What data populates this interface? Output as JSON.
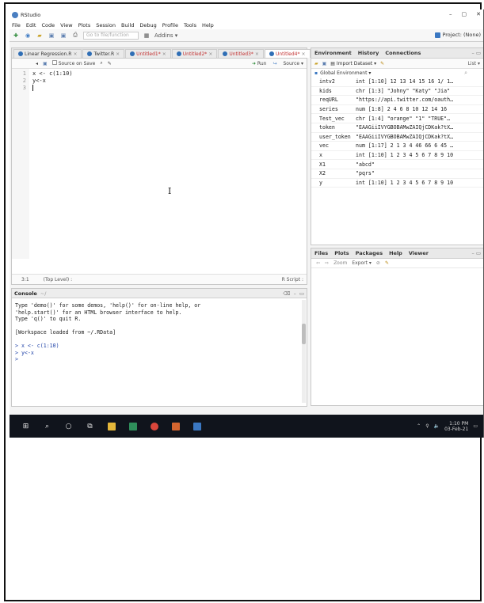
{
  "window": {
    "title": "RStudio",
    "controls": [
      "–",
      "▢",
      "✕"
    ]
  },
  "menu": [
    "File",
    "Edit",
    "Code",
    "View",
    "Plots",
    "Session",
    "Build",
    "Debug",
    "Profile",
    "Tools",
    "Help"
  ],
  "toolbar": {
    "goto_placeholder": "Go to file/function",
    "addins_label": "Addins ▾",
    "project_label": "Project: (None)"
  },
  "editor": {
    "tabs": [
      {
        "label": "Linear Regression.R",
        "active": false,
        "unsaved": false
      },
      {
        "label": "Twitter.R",
        "active": false,
        "unsaved": false
      },
      {
        "label": "Untitled1*",
        "active": false,
        "unsaved": true
      },
      {
        "label": "Untitled2*",
        "active": false,
        "unsaved": true
      },
      {
        "label": "Untitled3*",
        "active": false,
        "unsaved": true
      },
      {
        "label": "Untitled4*",
        "active": true,
        "unsaved": true
      }
    ],
    "source_on_save": "Source on Save",
    "run_label": "Run",
    "source_label": "Source ▾",
    "line_numbers": [
      "1",
      "2",
      "3"
    ],
    "code_lines": [
      "x <- c(1:10)",
      "y<-x",
      ""
    ],
    "status_pos": "3:1",
    "status_scope": "(Top Level) :",
    "status_type": "R Script :"
  },
  "console": {
    "title": "Console",
    "path": "~/",
    "lines": [
      "Type 'demo()' for some demos, 'help()' for on-line help, or",
      "'help.start()' for an HTML browser interface to help.",
      "Type 'q()' to quit R.",
      "",
      "[Workspace loaded from ~/.RData]",
      ""
    ],
    "prompt_lines": [
      "> x <- c(1:10)",
      "> y<-x",
      ">"
    ]
  },
  "environment": {
    "tabs": [
      "Environment",
      "History",
      "Connections"
    ],
    "import_label": "Import Dataset ▾",
    "list_label": "List ▾",
    "scope_label": "Global Environment ▾",
    "search_icon": "search-icon",
    "rows": [
      {
        "name": "intv2",
        "value": "int [1:10] 12 13 14 15 16 1/ 1…"
      },
      {
        "name": "kids",
        "value": "chr [1:3] \"Johny\" \"Katy\" \"Jia\""
      },
      {
        "name": "reqURL",
        "value": "\"https://api.twitter.com/oauth…"
      },
      {
        "name": "series",
        "value": "num [1:8] 2 4 6 8 10 12 14 16"
      },
      {
        "name": "Test_vec",
        "value": "chr [1:4] \"orange\" \"1\" \"TRUE\"…"
      },
      {
        "name": "token",
        "value": "\"EAAGiiIVYGBOBAMwZAIQjCDKak?tX…"
      },
      {
        "name": "user_token",
        "value": "\"EAAGiiIVYGBOBAMwZAIQjCDKak?tX…"
      },
      {
        "name": "vec",
        "value": "num [1:17] 2 1 3 4 46 66 6 45 …"
      },
      {
        "name": "x",
        "value": "int [1:10] 1 2 3 4 5 6 7 8 9 10"
      },
      {
        "name": "X1",
        "value": "\"abcd\""
      },
      {
        "name": "X2",
        "value": "\"pqrs\""
      },
      {
        "name": "y",
        "value": "int [1:10] 1 2 3 4 5 6 7 8 9 10"
      }
    ]
  },
  "files": {
    "tabs": [
      "Files",
      "Plots",
      "Packages",
      "Help",
      "Viewer"
    ],
    "zoom_label": "Zoom",
    "export_label": "Export ▾"
  },
  "taskbar": {
    "time": "1:10 PM",
    "date": "03-Feb-21"
  },
  "colors": {
    "accent": "#2f6eb5",
    "taskbar": "#10141c",
    "unsaved": "#c23030"
  }
}
